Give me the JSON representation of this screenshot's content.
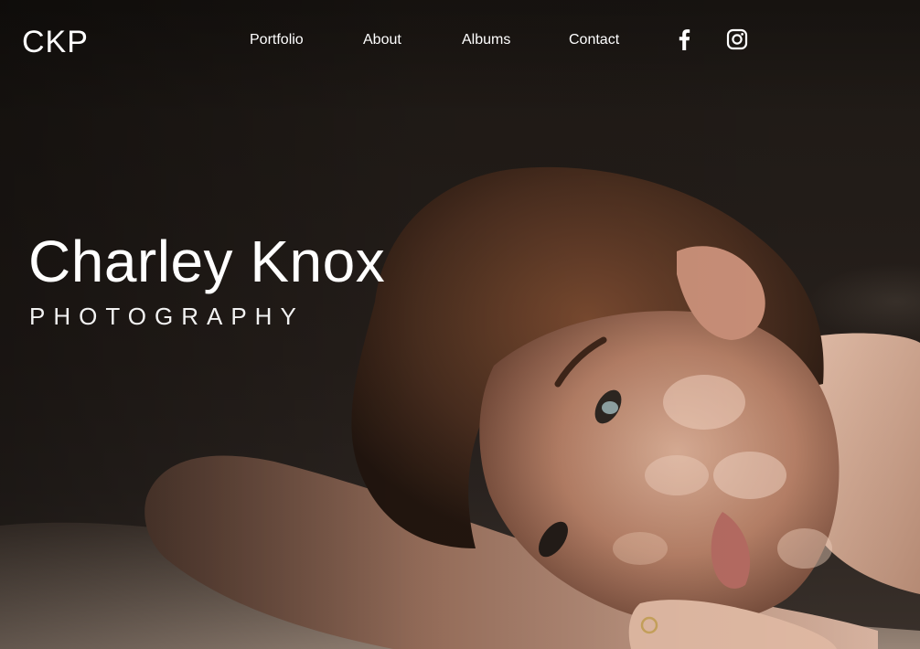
{
  "header": {
    "logo": "CKP",
    "nav": [
      {
        "label": "Portfolio"
      },
      {
        "label": "About"
      },
      {
        "label": "Albums"
      },
      {
        "label": "Contact"
      }
    ],
    "social": [
      {
        "icon": "facebook-icon"
      },
      {
        "icon": "instagram-icon"
      }
    ]
  },
  "hero": {
    "title": "Charley Knox",
    "subtitle": "PHOTOGRAPHY",
    "image_subject": "portrait of a woman with brown hair resting her head on her arm in dappled sunlight"
  },
  "colors": {
    "text": "#ffffff",
    "background": "#1b1714",
    "skin": "#c89a80",
    "hair": "#4a2e1f"
  }
}
